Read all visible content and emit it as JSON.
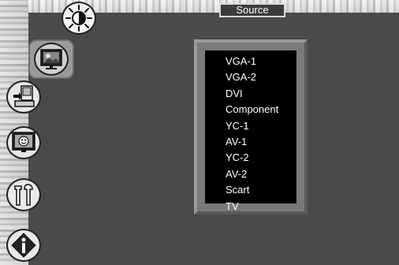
{
  "menu": {
    "title": "Source",
    "items": [
      {
        "label": "VGA-1"
      },
      {
        "label": "VGA-2"
      },
      {
        "label": "DVI"
      },
      {
        "label": "Component"
      },
      {
        "label": "YC-1"
      },
      {
        "label": "AV-1"
      },
      {
        "label": "YC-2"
      },
      {
        "label": "AV-2"
      },
      {
        "label": "Scart"
      },
      {
        "label": "TV"
      }
    ]
  },
  "sidebar": {
    "icons": [
      {
        "name": "brightness-icon"
      },
      {
        "name": "picture-icon"
      },
      {
        "name": "input-icon"
      },
      {
        "name": "display-icon"
      },
      {
        "name": "tools-icon"
      },
      {
        "name": "info-icon"
      }
    ]
  },
  "colors": {
    "background": "#4a4a4a",
    "list_background": "#000000",
    "text": "#ffffff"
  }
}
